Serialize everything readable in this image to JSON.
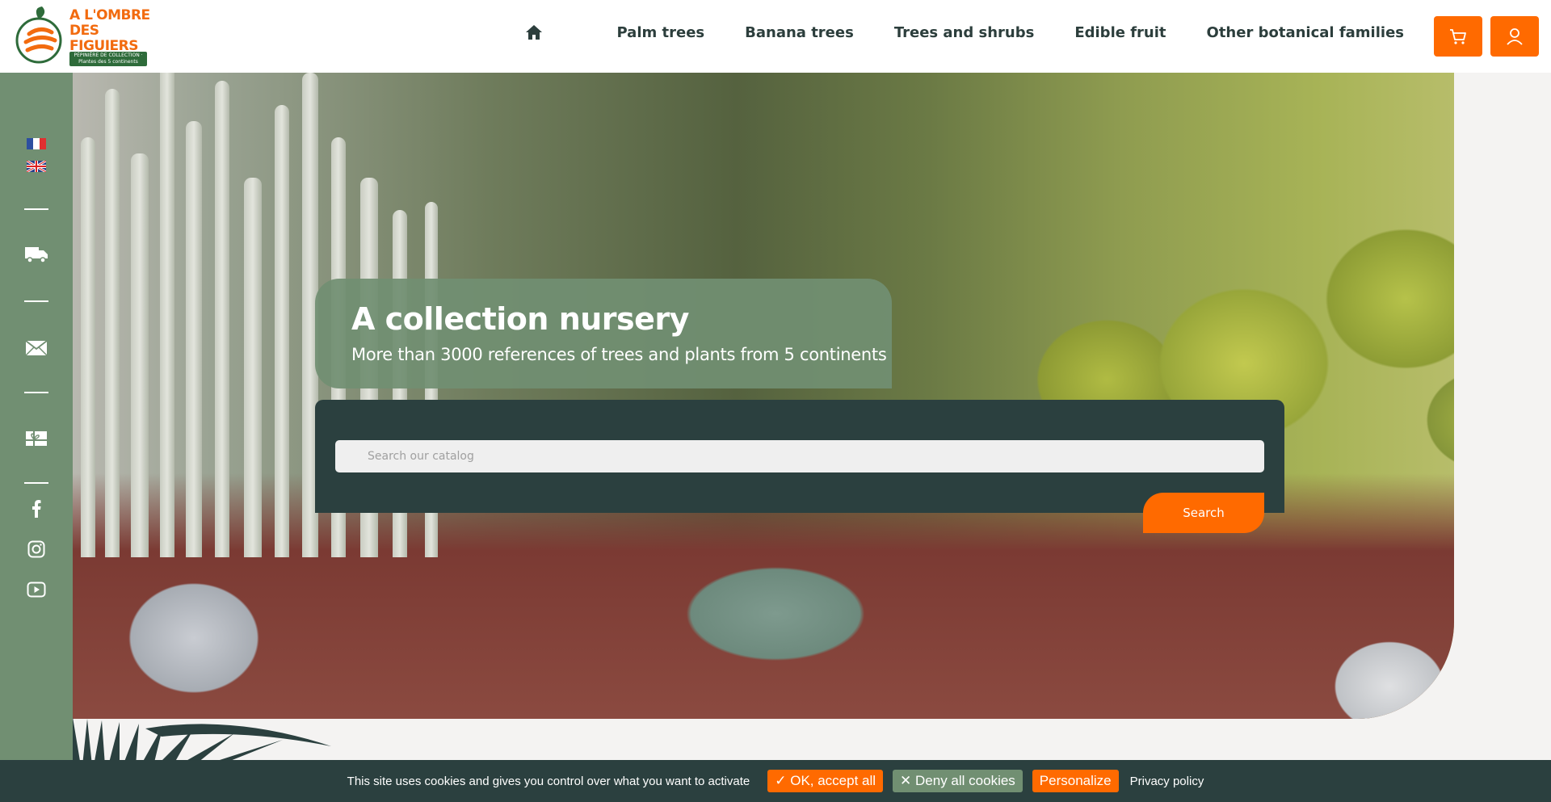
{
  "header": {
    "logo_line1": "A L'OMBRE",
    "logo_line2": "DES FIGUIERS",
    "logo_badge": "PÉPINIÈRE DE COLLECTION · Plantes des 5 continents",
    "nav": [
      {
        "label": "Palm trees"
      },
      {
        "label": "Banana trees"
      },
      {
        "label": "Trees and shrubs"
      },
      {
        "label": "Edible fruit"
      },
      {
        "label": "Other botanical families"
      }
    ],
    "icons": {
      "home": "home-icon",
      "cart": "cart-icon",
      "user": "user-icon"
    }
  },
  "sidebar": {
    "languages": [
      "French",
      "English"
    ],
    "icons": [
      "truck-icon",
      "envelope-icon",
      "gift-card-icon",
      "facebook-icon",
      "instagram-icon",
      "youtube-icon"
    ]
  },
  "hero": {
    "title": "A collection nursery",
    "subtitle": "More than 3000 references of trees and plants from 5 continents"
  },
  "search": {
    "placeholder": "Search our catalog",
    "button_label": "Search"
  },
  "cookie_bar": {
    "text": "This site uses cookies and gives you control over what you want to activate",
    "accept_label": "OK, accept all",
    "deny_label": "Deny all cookies",
    "personalize_label": "Personalize",
    "privacy_label": "Privacy policy"
  },
  "colors": {
    "accent_orange": "#ff6a00",
    "sidebar_green": "#718f72",
    "dark_teal": "#2b403f",
    "nav_text": "#2c3e3c"
  }
}
